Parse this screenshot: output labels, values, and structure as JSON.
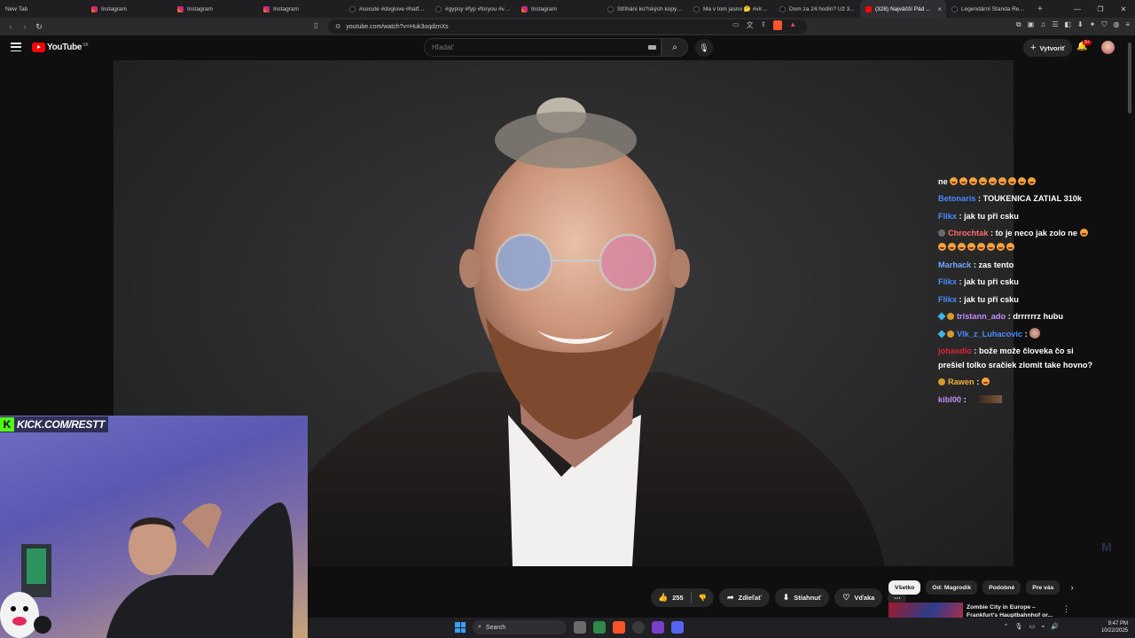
{
  "browser": {
    "tabs": [
      {
        "label": "New Tab",
        "fav": "none",
        "active": false
      },
      {
        "label": "Instagram",
        "fav": "ig",
        "active": false
      },
      {
        "label": "Instagram",
        "fav": "ig",
        "active": false
      },
      {
        "label": "Instagram",
        "fav": "ig",
        "active": false
      },
      {
        "label": "#socute #doglove #hatfbl...",
        "fav": "tt",
        "active": false
      },
      {
        "label": "#gypsy #fyp #foryou #viral",
        "fav": "tt",
        "active": false
      },
      {
        "label": "Instagram",
        "fav": "ig",
        "active": false
      },
      {
        "label": "Stříhání ko?ských kopyt: Pr...",
        "fav": "tt",
        "active": false
      },
      {
        "label": "Ma v tom jasno 🤔 #viral #...",
        "fav": "tt",
        "active": false
      },
      {
        "label": "Dom za 24 hodín? Už 3...",
        "fav": "tt",
        "active": false
      },
      {
        "label": "(328) Najväčší Pád ...",
        "fav": "yt",
        "active": true
      },
      {
        "label": "Legendární Standa Řezáč ...",
        "fav": "tt",
        "active": false
      }
    ],
    "new_tab_icon": "plus-icon",
    "url": "youtube.com/watch?v=Huk3oqdznXs"
  },
  "youtube": {
    "logo_text": "YouTube",
    "country_code": "SK",
    "search_placeholder": "Hľadať",
    "create_label": "Vytvoriť",
    "notification_count": "9+"
  },
  "overlay": {
    "kick_text": "KICK.COM/RESTT",
    "chat": [
      {
        "user": "",
        "text": "ne",
        "emotes": 9,
        "user_color": "#ff8a3d"
      },
      {
        "user": "Betonaris",
        "text": ": TOUKENICA ZATIAL 310k",
        "user_color": "#4a8cff"
      },
      {
        "user": "Flikx",
        "text": ": jak tu při csku",
        "user_color": "#4a8cff"
      },
      {
        "user": "Chrochtak",
        "text": ": to je neco jak zolo ne",
        "emotes": 9,
        "user_color": "#ff6b6b"
      },
      {
        "user": "Marhack",
        "text": ": zas tento",
        "user_color": "#6fa8ff"
      },
      {
        "user": "Flikx",
        "text": ": jak tu při csku",
        "user_color": "#4a8cff"
      },
      {
        "user": "Flikx",
        "text": ": jak tu při csku",
        "user_color": "#4a8cff"
      },
      {
        "user": "tristann_ado",
        "text": ": drrrrrrz hubu",
        "user_color": "#c58cff"
      },
      {
        "user": "Vlk_z_Luhacovic",
        "text": ":",
        "user_color": "#4a8cff"
      },
      {
        "user": "johasdio",
        "text": ": bože može človeka čo si prešiel tolko sračiek zlomit take hovno?",
        "user_color": "#e0223a"
      },
      {
        "user": "Rawen",
        "text": ":",
        "user_color": "#f2b233"
      },
      {
        "user": "kibl00",
        "text": ":",
        "user_color": "#c58cff"
      }
    ]
  },
  "actions": {
    "like_count": "255",
    "share_label": "Zdieľať",
    "download_label": "Stiahnuť",
    "thanks_label": "Vďaka"
  },
  "chips": [
    "Všetko",
    "Od: Magrodik",
    "Podobné",
    "Pre vás"
  ],
  "recommendation": {
    "title": "Zombie City in Europe – Frankfurt's Hauptbahnhof or..."
  },
  "taskbar": {
    "search_label": "Search",
    "time": "9:47 PM",
    "date": "10/22/2025"
  }
}
